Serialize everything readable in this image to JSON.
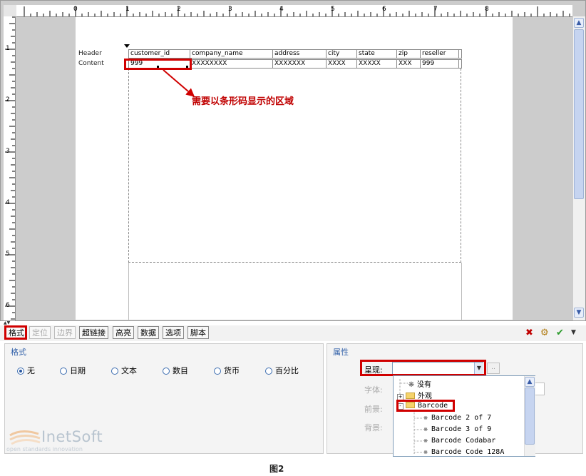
{
  "ruler": {
    "h_numbers": [
      "0",
      "1",
      "2",
      "3",
      "4",
      "5",
      "6",
      "7",
      "8"
    ],
    "v_numbers": [
      "1",
      "2",
      "3",
      "4",
      "5",
      "6"
    ]
  },
  "report": {
    "row_labels": {
      "header": "Header",
      "content": "Content"
    },
    "columns": [
      {
        "header": "customer_id",
        "content": "999"
      },
      {
        "header": "company_name",
        "content": "XXXXXXXX"
      },
      {
        "header": "address",
        "content": "XXXXXXX"
      },
      {
        "header": "city",
        "content": "XXXX"
      },
      {
        "header": "state",
        "content": "XXXXX"
      },
      {
        "header": "zip",
        "content": "XXX"
      },
      {
        "header": "reseller",
        "content": "999"
      }
    ],
    "annotation": "需要以条形码显示的区域"
  },
  "tabs": [
    {
      "label": "格式",
      "enabled": true,
      "active": true
    },
    {
      "label": "定位",
      "enabled": false
    },
    {
      "label": "边界",
      "enabled": false
    },
    {
      "label": "超链接",
      "enabled": true
    },
    {
      "label": "高亮",
      "enabled": true
    },
    {
      "label": "数据",
      "enabled": true
    },
    {
      "label": "选项",
      "enabled": true
    },
    {
      "label": "脚本",
      "enabled": true
    }
  ],
  "toolbar_icons": [
    "close-icon",
    "settings-icon",
    "check-icon",
    "menu-arrow-icon"
  ],
  "format": {
    "title": "格式",
    "options": [
      {
        "label": "无",
        "selected": true
      },
      {
        "label": "日期",
        "selected": false
      },
      {
        "label": "文本",
        "selected": false
      },
      {
        "label": "数目",
        "selected": false
      },
      {
        "label": "货币",
        "selected": false
      },
      {
        "label": "百分比",
        "selected": false
      }
    ]
  },
  "properties": {
    "title": "属性",
    "present_label": "呈现:",
    "font_label": "字体:",
    "foreground_label": "前景:",
    "background_label": "背景:"
  },
  "dropdown": {
    "items": [
      {
        "label": "没有",
        "kind": "leaf",
        "level": 1
      },
      {
        "label": "外观",
        "kind": "folder",
        "expander": "+",
        "level": 0
      },
      {
        "label": "Barcode",
        "kind": "folder",
        "expander": "-",
        "level": 0
      },
      {
        "label": "Barcode 2 of 7",
        "kind": "leaf",
        "level": 2
      },
      {
        "label": "Barcode 3 of 9",
        "kind": "leaf",
        "level": 2
      },
      {
        "label": "Barcode Codabar",
        "kind": "leaf",
        "level": 2
      },
      {
        "label": "Barcode Code 128A",
        "kind": "leaf",
        "level": 2
      }
    ]
  },
  "logo": {
    "name": "InetSoft",
    "tagline": "open standards innovation"
  },
  "caption": "图2",
  "colors": {
    "highlight": "#d00000",
    "annotation_text": "#c00000",
    "section_title": "#3160a8"
  }
}
